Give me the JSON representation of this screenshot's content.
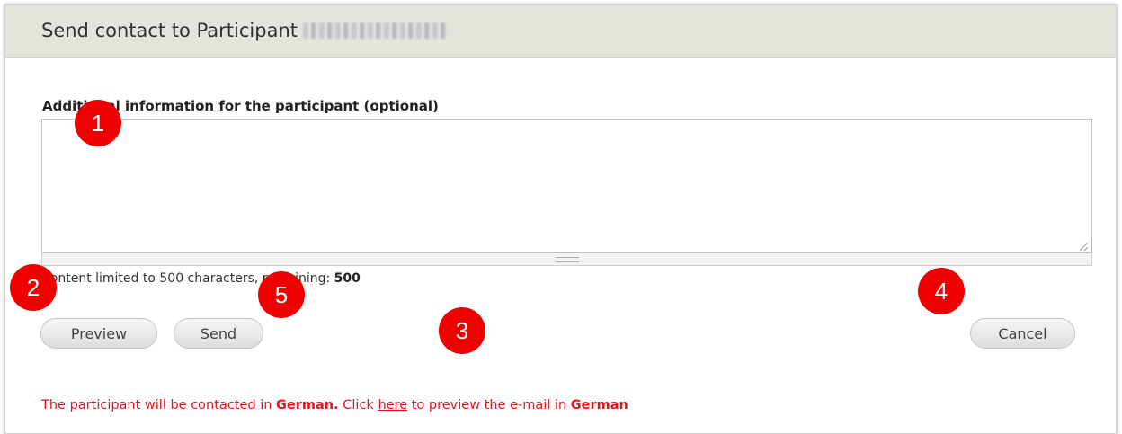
{
  "dialog": {
    "title": "Send contact to Participant",
    "field_label": "Additional information for the participant (optional)",
    "textarea_value": "",
    "limit_prefix": "Content limited to 500 characters, remaining: ",
    "limit_remaining": "500",
    "buttons": {
      "preview": "Preview",
      "send": "Send",
      "cancel": "Cancel"
    },
    "notice": {
      "part1": "The participant will be contacted in ",
      "lang1": "German.",
      "part2": " Click ",
      "link": "here",
      "part3": " to preview the e-mail in ",
      "lang2": "German"
    }
  },
  "markers": [
    "1",
    "2",
    "3",
    "4",
    "5"
  ],
  "colors": {
    "notice": "#e2141c",
    "marker": "#ee0000",
    "titlebar": "#e4e3dc"
  }
}
